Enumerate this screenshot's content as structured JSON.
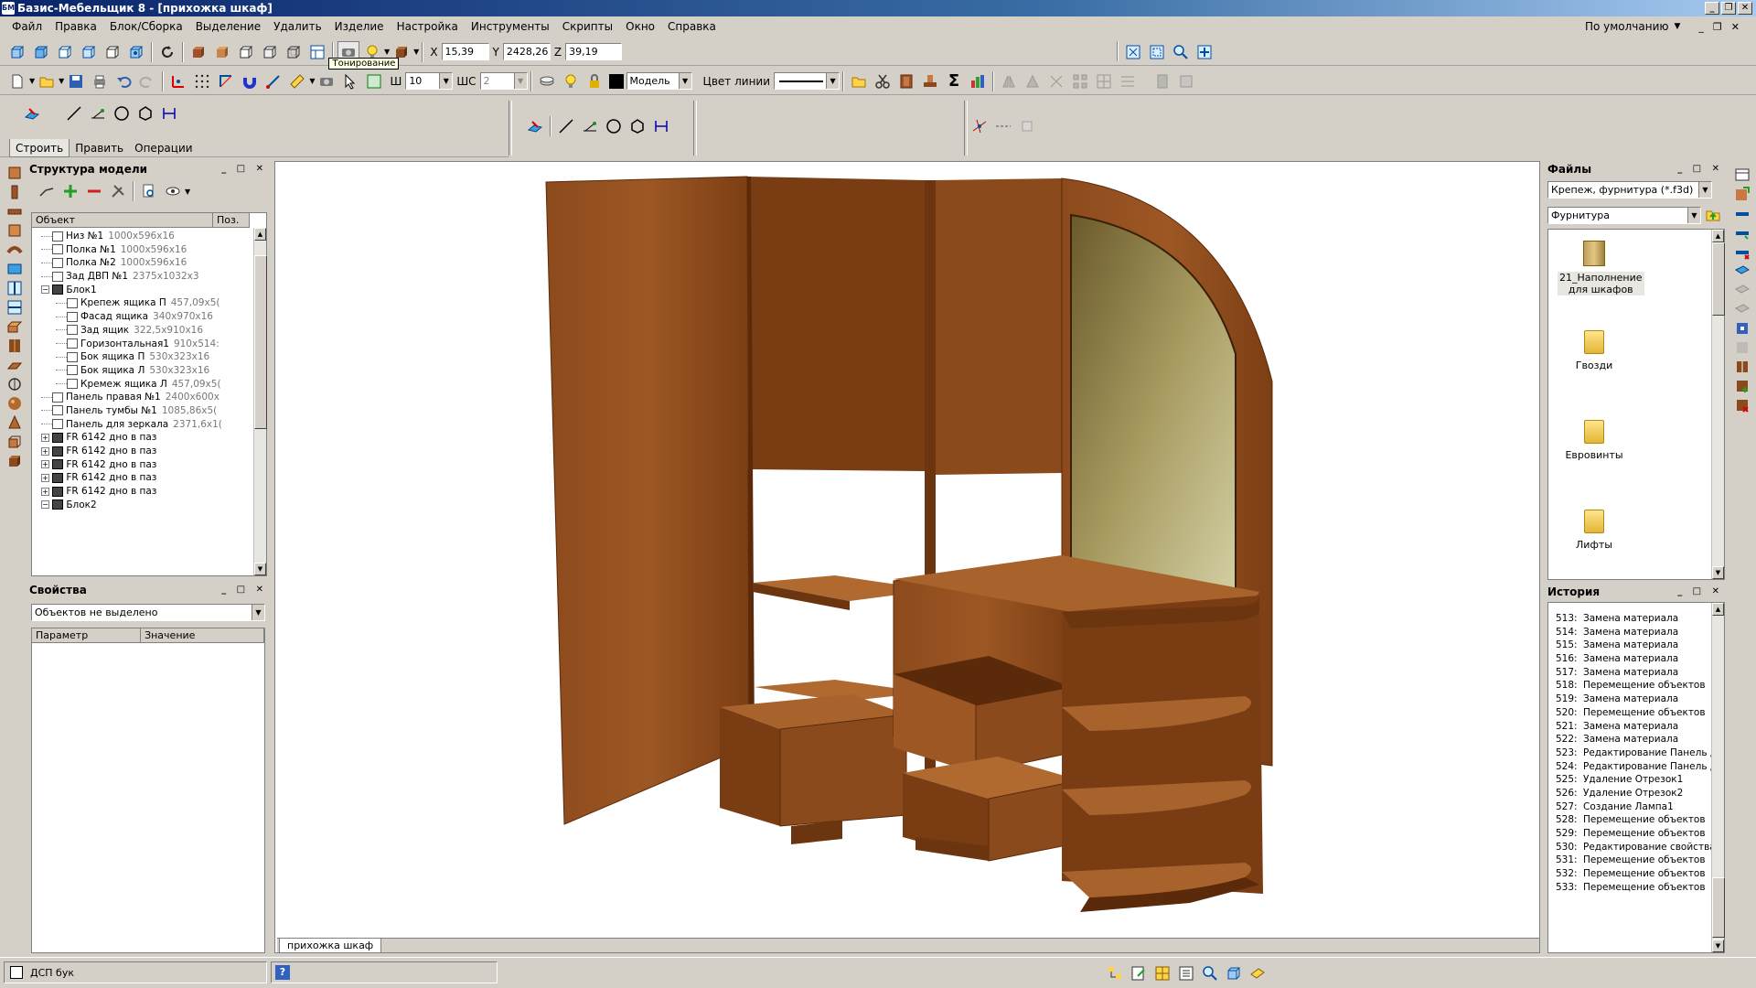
{
  "window": {
    "title": "Базис-Мебельщик 8 - [прихожка  шкаф]",
    "icon": "app-icon-bb"
  },
  "menu": {
    "items": [
      "Файл",
      "Правка",
      "Блок/Сборка",
      "Выделение",
      "Удалить",
      "Изделие",
      "Настройка",
      "Инструменты",
      "Скрипты",
      "Окно",
      "Справка"
    ],
    "workspace": "По умолчанию"
  },
  "coords": {
    "x_label": "X",
    "x": "15,39",
    "y_label": "Y",
    "y": "2428,26",
    "z_label": "Z",
    "z": "39,19"
  },
  "toolbar2": {
    "tooltip": "Тонирование",
    "step_label": "Ш",
    "step_value": "10",
    "shc_label": "ШС",
    "shc_value": "2",
    "layer": "Модель",
    "line_color_label": "Цвет линии"
  },
  "draw_tabs": [
    "Строить",
    "Править",
    "Операции"
  ],
  "structure": {
    "title": "Структура модели",
    "col_object": "Объект",
    "col_pos": "Поз.",
    "rows": [
      {
        "name": "Низ №1",
        "dim": "1000x596x16"
      },
      {
        "name": "Полка №1",
        "dim": "1000x596x16"
      },
      {
        "name": "Полка №2",
        "dim": "1000x596x16"
      },
      {
        "name": "Зад ДВП №1",
        "dim": "2375x1032x3"
      },
      {
        "name": "Блок1",
        "dim": ""
      },
      {
        "name": "Крепеж ящика П",
        "dim": "457,09x5("
      },
      {
        "name": "Фасад ящика",
        "dim": "340x970x16"
      },
      {
        "name": "Зад ящик",
        "dim": "322,5x910x16"
      },
      {
        "name": "Горизонтальная1",
        "dim": "910x514:"
      },
      {
        "name": "Бок ящика П",
        "dim": "530x323x16"
      },
      {
        "name": "Бок ящика Л",
        "dim": "530x323x16"
      },
      {
        "name": "Кремеж ящика Л",
        "dim": "457,09x5("
      },
      {
        "name": "Панель правая №1",
        "dim": "2400x600x"
      },
      {
        "name": "Панель  тумбы №1",
        "dim": "1085,86x5("
      },
      {
        "name": "Панель для зеркала",
        "dim": "2371,6x1("
      },
      {
        "name": "FR 6142 дно в паз",
        "dim": ""
      },
      {
        "name": "FR 6142 дно в паз",
        "dim": ""
      },
      {
        "name": "FR 6142 дно в паз",
        "dim": ""
      },
      {
        "name": "FR 6142 дно в паз",
        "dim": ""
      },
      {
        "name": "FR 6142 дно в паз",
        "dim": ""
      },
      {
        "name": "Блок2",
        "dim": ""
      }
    ]
  },
  "properties": {
    "title": "Свойства",
    "selection": "Объектов не выделено",
    "col_param": "Параметр",
    "col_value": "Значение"
  },
  "files": {
    "title": "Файлы",
    "filter": "Крепеж, фурнитура (*.f3d)",
    "folder": "Фурнитура",
    "items": [
      "21_Наполнение для шкафов",
      "Гвозди",
      "Евровинты",
      "Лифты"
    ]
  },
  "history": {
    "title": "История",
    "rows": [
      {
        "n": "513:",
        "t": "Замена материала"
      },
      {
        "n": "514:",
        "t": "Замена материала"
      },
      {
        "n": "515:",
        "t": "Замена материала"
      },
      {
        "n": "516:",
        "t": "Замена материала"
      },
      {
        "n": "517:",
        "t": "Замена материала"
      },
      {
        "n": "518:",
        "t": "Перемещение объектов"
      },
      {
        "n": "519:",
        "t": "Замена материала"
      },
      {
        "n": "520:",
        "t": "Перемещение объектов"
      },
      {
        "n": "521:",
        "t": "Замена материала"
      },
      {
        "n": "522:",
        "t": "Замена материала"
      },
      {
        "n": "523:",
        "t": "Редактирование Панель д"
      },
      {
        "n": "524:",
        "t": "Редактирование Панель д"
      },
      {
        "n": "525:",
        "t": "Удаление Отрезок1"
      },
      {
        "n": "526:",
        "t": "Удаление Отрезок2"
      },
      {
        "n": "527:",
        "t": "Создание Лампа1"
      },
      {
        "n": "528:",
        "t": "Перемещение объектов"
      },
      {
        "n": "529:",
        "t": "Перемещение объектов"
      },
      {
        "n": "530:",
        "t": "Редактирование свойства"
      },
      {
        "n": "531:",
        "t": "Перемещение объектов"
      },
      {
        "n": "532:",
        "t": "Перемещение объектов"
      },
      {
        "n": "533:",
        "t": "Перемещение объектов"
      }
    ]
  },
  "document_tab": "прихожка  шкаф",
  "status": {
    "material": "ДСП бук",
    "help": "?"
  },
  "colors": {
    "titlebar": "#0a246a",
    "wood": "#8a4a1e",
    "wood_light": "#a8632c",
    "mirror": "#b9b78a",
    "chrome": "#d4d0c8"
  }
}
